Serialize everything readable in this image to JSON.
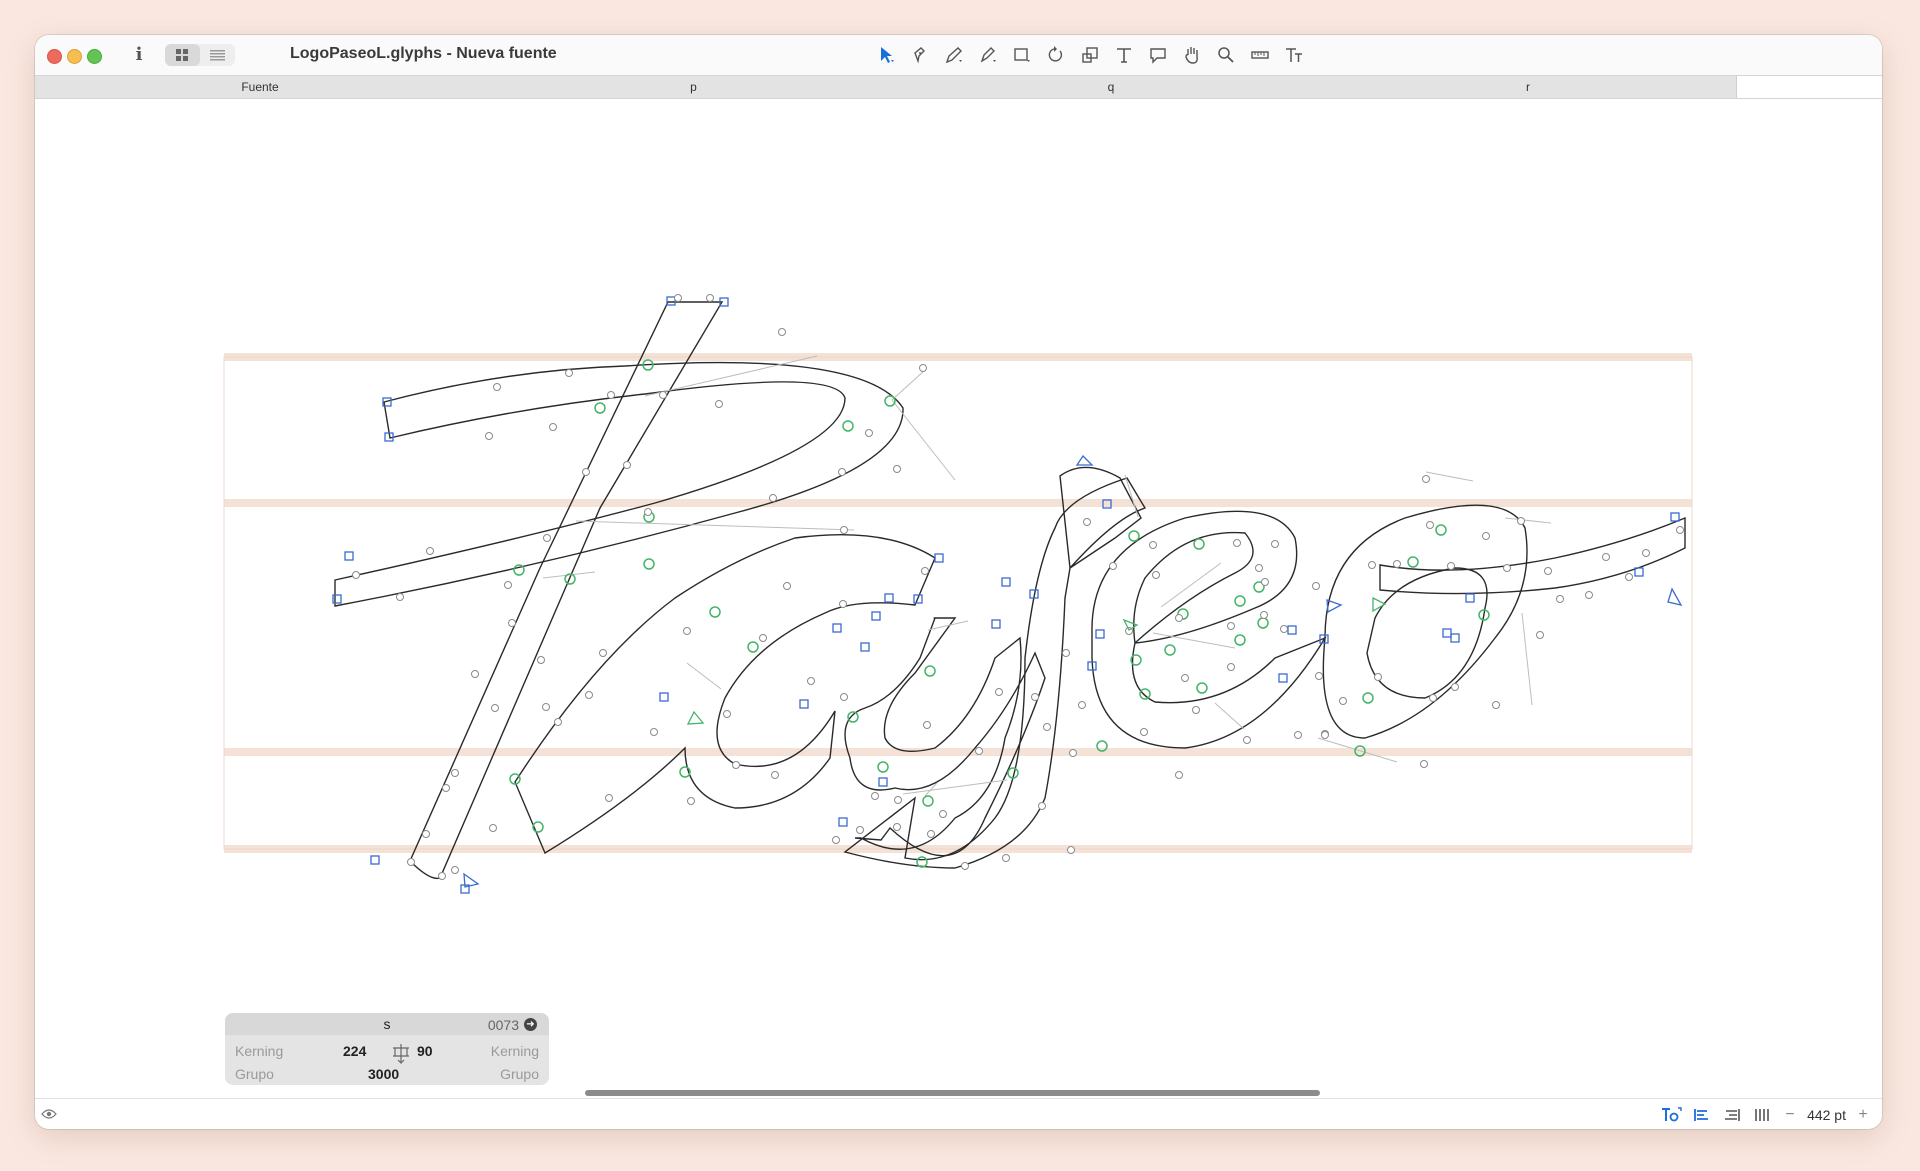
{
  "window": {
    "title": "LogoPaseoL.glyphs - Nueva fuente"
  },
  "titlebar": {
    "info_label": "i",
    "tools": [
      {
        "name": "select-tool-icon",
        "active": true
      },
      {
        "name": "draw-tool-icon"
      },
      {
        "name": "pen-tool-icon"
      },
      {
        "name": "pencil-tool-icon"
      },
      {
        "name": "rectangle-tool-icon"
      },
      {
        "name": "rotate-tool-icon"
      },
      {
        "name": "scale-tool-icon"
      },
      {
        "name": "text-tool-icon"
      },
      {
        "name": "annotation-tool-icon"
      },
      {
        "name": "hand-tool-icon"
      },
      {
        "name": "zoom-tool-icon"
      },
      {
        "name": "measure-tool-icon"
      },
      {
        "name": "type-tool-icon"
      }
    ]
  },
  "tabs": [
    {
      "label": "Fuente"
    },
    {
      "label": "p"
    },
    {
      "label": "q"
    },
    {
      "label": "r"
    }
  ],
  "infobox": {
    "glyph": "s",
    "unicode": "0073",
    "kerning_left_label": "Kerning",
    "kerning_right_label": "Kerning",
    "lsb": "224",
    "rsb": "90",
    "group_left_label": "Grupo",
    "group_right_label": "Grupo",
    "width": "3000"
  },
  "statusbar": {
    "zoom": "442 pt",
    "zoom_minus": "−",
    "zoom_plus": "+"
  },
  "colors": {
    "accent": "#1a6fd8",
    "guideline": "#f4e2d6",
    "node_green": "#45b469",
    "node_blue": "#3b6bcf",
    "background": "#fae8e0"
  }
}
